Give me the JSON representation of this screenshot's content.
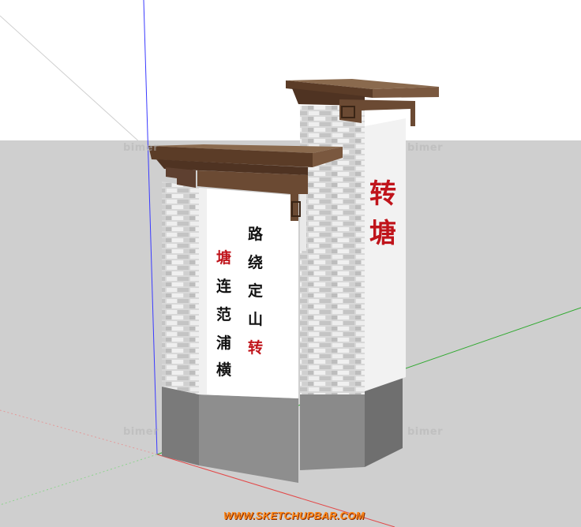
{
  "viewport": {
    "watermark_text": "bimer",
    "site_url": "WWW.SKETCHUPBAR.COM"
  },
  "front_pillar": {
    "inscription_col1": [
      "路",
      "绕",
      "定",
      "山",
      "转"
    ],
    "inscription_col2": [
      "塘",
      "连",
      "范",
      "浦",
      "横"
    ]
  },
  "back_pillar": {
    "inscription": [
      "转",
      "塘"
    ]
  },
  "colors": {
    "sky": "#ffffff",
    "ground": "#cfcfcf",
    "brick_light": "#ececec",
    "brick_dark": "#b9b9b9",
    "wood_cap": "#6b4a33",
    "plinth": "#7d7d7d",
    "text_black": "#111111",
    "text_red": "#c0141b",
    "axis_blue": "#3a3aff",
    "axis_green": "#2fa92f",
    "axis_red": "#e34848",
    "url_orange": "#ff8a1a"
  }
}
